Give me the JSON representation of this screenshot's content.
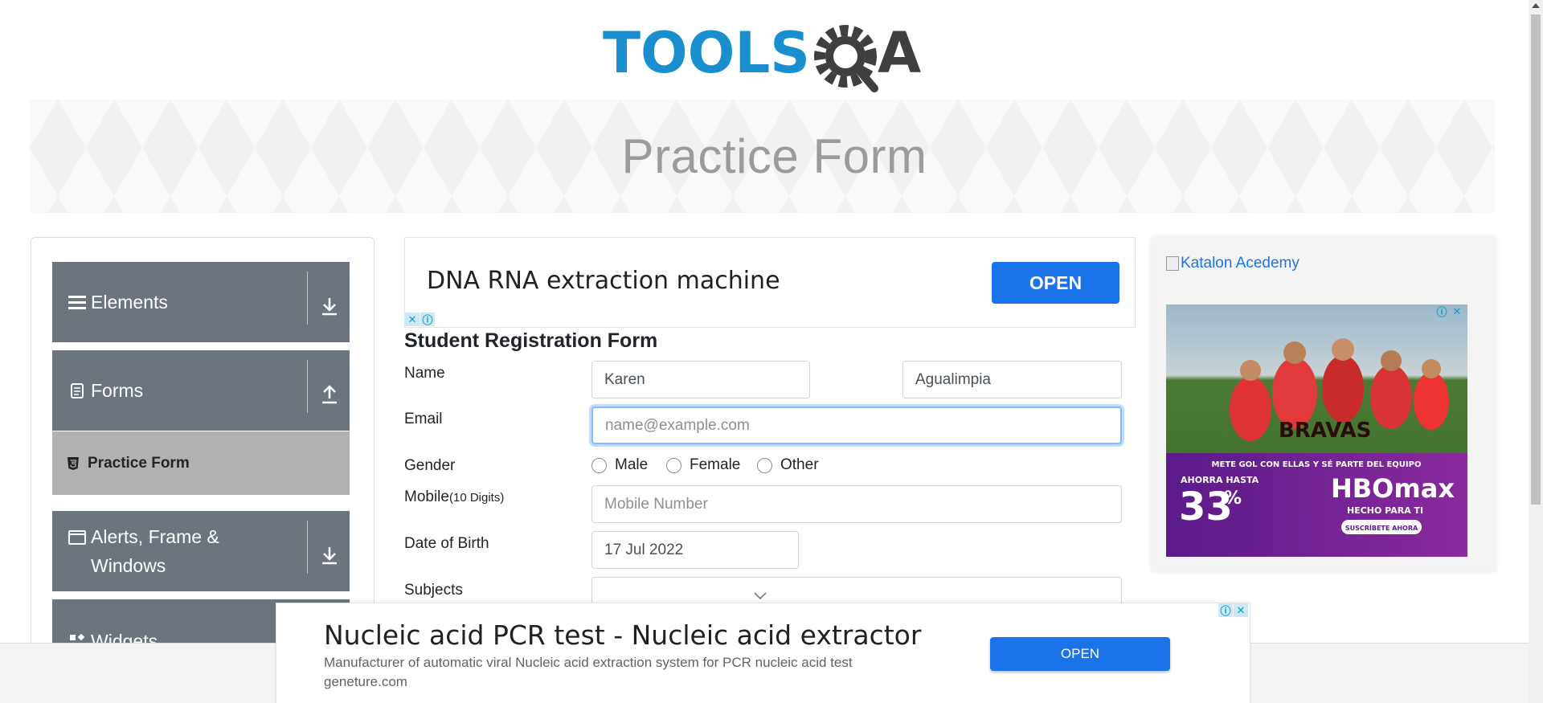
{
  "header": {
    "logo_text": "TOOLSQA",
    "page_title": "Practice Form"
  },
  "sidebar": {
    "groups": [
      {
        "label": "Elements",
        "icon": "hamburger-icon",
        "toggle": "download-arrow-icon"
      },
      {
        "label": "Forms",
        "icon": "document-icon",
        "toggle": "upload-arrow-icon"
      },
      {
        "label": "Alerts, Frame & Windows",
        "icon": "window-icon",
        "toggle": "download-arrow-icon"
      },
      {
        "label": "Widgets",
        "icon": "widgets-icon",
        "toggle": "download-arrow-icon"
      }
    ],
    "active_item": {
      "label": "Practice Form",
      "icon": "html5-icon"
    }
  },
  "ads": {
    "top": {
      "title": "DNA RNA extraction machine",
      "button": "OPEN"
    },
    "right": {
      "link_text": "Katalon Acedemy",
      "promo_team": "BRAVAS",
      "promo_line": "METE GOL CON ELLAS Y SÉ PARTE DEL EQUIPO",
      "promo_save_prefix": "AHORRA HASTA",
      "promo_percent": "33",
      "promo_percent_sign": "%",
      "promo_brand": "HBOmax",
      "promo_tag": "HECHO PARA TI",
      "promo_cta": "SUSCRÍBETE AHORA"
    },
    "bottom": {
      "title": "Nucleic acid PCR test - Nucleic acid extractor",
      "description": "Manufacturer of automatic viral Nucleic acid extraction system for PCR nucleic acid test",
      "url": "geneture.com",
      "button": "OPEN"
    }
  },
  "form": {
    "title": "Student Registration Form",
    "labels": {
      "name": "Name",
      "email": "Email",
      "gender": "Gender",
      "mobile": "Mobile",
      "mobile_hint": "(10 Digits)",
      "dob": "Date of Birth",
      "subjects": "Subjects"
    },
    "first_name": "Karen",
    "last_name": "Agualimpia",
    "email_placeholder": "name@example.com",
    "mobile_placeholder": "Mobile Number",
    "dob_value": "17 Jul 2022",
    "gender_options": [
      "Male",
      "Female",
      "Other"
    ]
  },
  "colors": {
    "sidebar_bg": "#6c757d",
    "active_item_bg": "#b1b1b1",
    "ad_button": "#1a73e8",
    "logo_blue": "#1a8fd0",
    "logo_gray": "#3f3f3f"
  }
}
